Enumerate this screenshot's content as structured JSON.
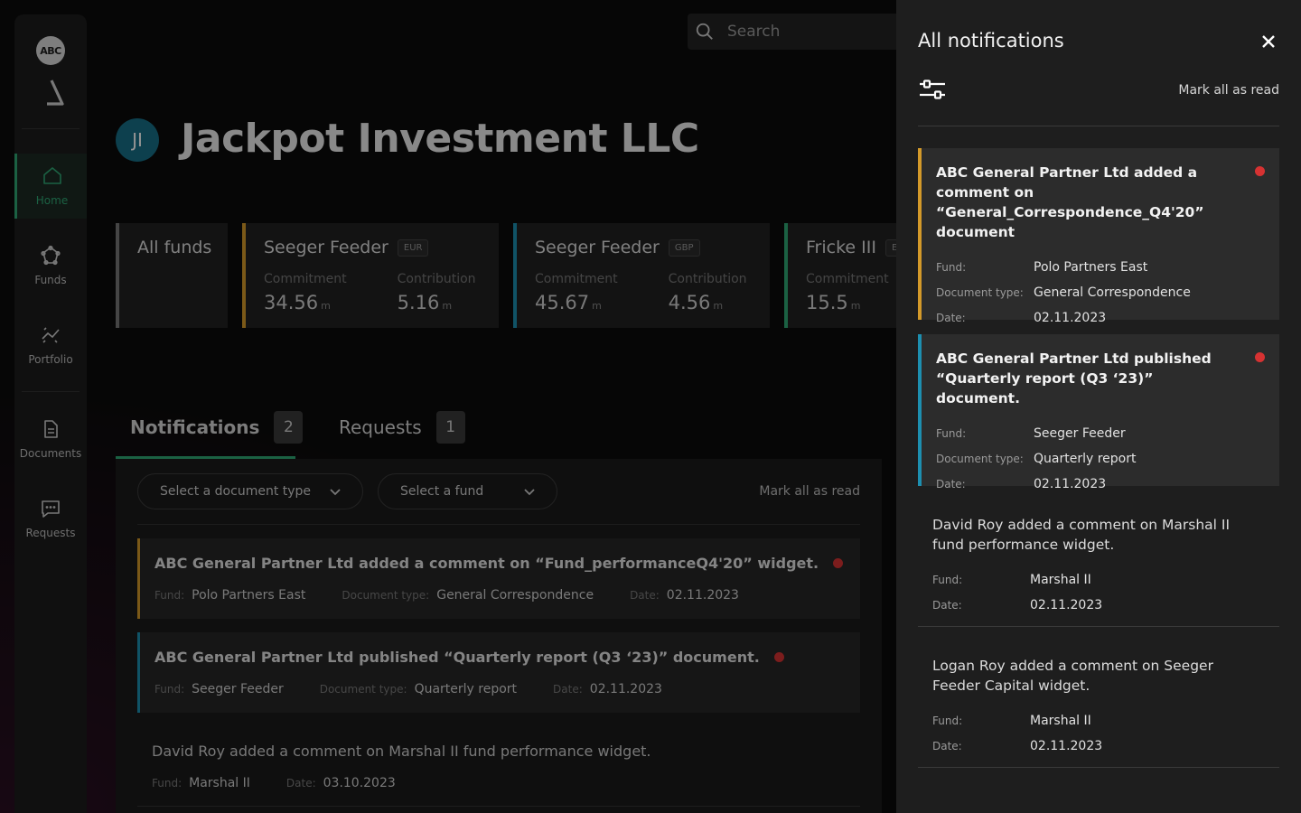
{
  "brand": {
    "logo_text": "ABC"
  },
  "search": {
    "placeholder": "Search"
  },
  "sidebar": {
    "items": [
      {
        "label": "Home",
        "icon": "home-icon"
      },
      {
        "label": "Funds",
        "icon": "funds-icon"
      },
      {
        "label": "Portfolio",
        "icon": "portfolio-icon"
      },
      {
        "label": "Documents",
        "icon": "document-icon"
      },
      {
        "label": "Requests",
        "icon": "message-icon"
      }
    ],
    "active_color": "#2fa874"
  },
  "header": {
    "avatar_initials": "JI",
    "title": "Jackpot Investment LLC"
  },
  "funds": {
    "all_label": "All funds",
    "commitment_label": "Commitment",
    "contribution_label": "Contribution",
    "unit": "m",
    "cards": [
      {
        "name": "Seeger Feeder",
        "currency": "EUR",
        "commitment": "34.56",
        "contribution": "5.16",
        "accent": "#d49a2a"
      },
      {
        "name": "Seeger Feeder",
        "currency": "GBP",
        "commitment": "45.67",
        "contribution": "4.56",
        "accent": "#1d8fb0"
      },
      {
        "name": "Fricke III",
        "currency": "EU",
        "commitment": "15.5",
        "contribution": "",
        "accent": "#2fa874"
      }
    ]
  },
  "tabs": [
    {
      "label": "Notifications",
      "count": "2"
    },
    {
      "label": "Requests",
      "count": "1"
    }
  ],
  "filters": {
    "document_type": "Select a document type",
    "fund": "Select a fund",
    "mark_all": "Mark all as read"
  },
  "meta_labels": {
    "fund": "Fund:",
    "doc_type": "Document type:",
    "date": "Date:"
  },
  "notifications": [
    {
      "title": "ABC General Partner Ltd added a comment on “Fund_performanceQ4'20” widget.",
      "fund": "Polo Partners East",
      "doc_type": "General Correspondence",
      "date": "02.11.2023"
    },
    {
      "title": "ABC General Partner Ltd published “Quarterly report (Q3 ‘23)” document.",
      "fund": "Seeger Feeder",
      "doc_type": "Quarterly report",
      "date": "02.11.2023"
    },
    {
      "title": "David Roy added a comment on Marshal II fund performance widget.",
      "fund": "Marshal II",
      "date": "03.10.2023"
    }
  ],
  "drawer": {
    "title": "All notifications",
    "mark_all": "Mark all as read",
    "items": [
      {
        "title": "ABC General Partner Ltd added a comment on “General_Correspondence_Q4'20” document",
        "fund": "Polo Partners East",
        "doc_type": "General Correspondence",
        "date": "02.11.2023"
      },
      {
        "title": "ABC General Partner Ltd published “Quarterly report (Q3 ‘23)” document.",
        "fund": "Seeger Feeder",
        "doc_type": "Quarterly report",
        "date": "02.11.2023"
      },
      {
        "title": "David Roy added a comment on Marshal II fund performance widget.",
        "fund": "Marshal II",
        "date": "02.11.2023"
      },
      {
        "title": "Logan Roy added a comment on Seeger Feeder Capital widget.",
        "fund": "Marshal II",
        "date": "02.11.2023"
      }
    ]
  },
  "colors": {
    "accent_orange": "#d49a2a",
    "accent_blue": "#1d8fb0",
    "unread_dot": "#d63232"
  }
}
